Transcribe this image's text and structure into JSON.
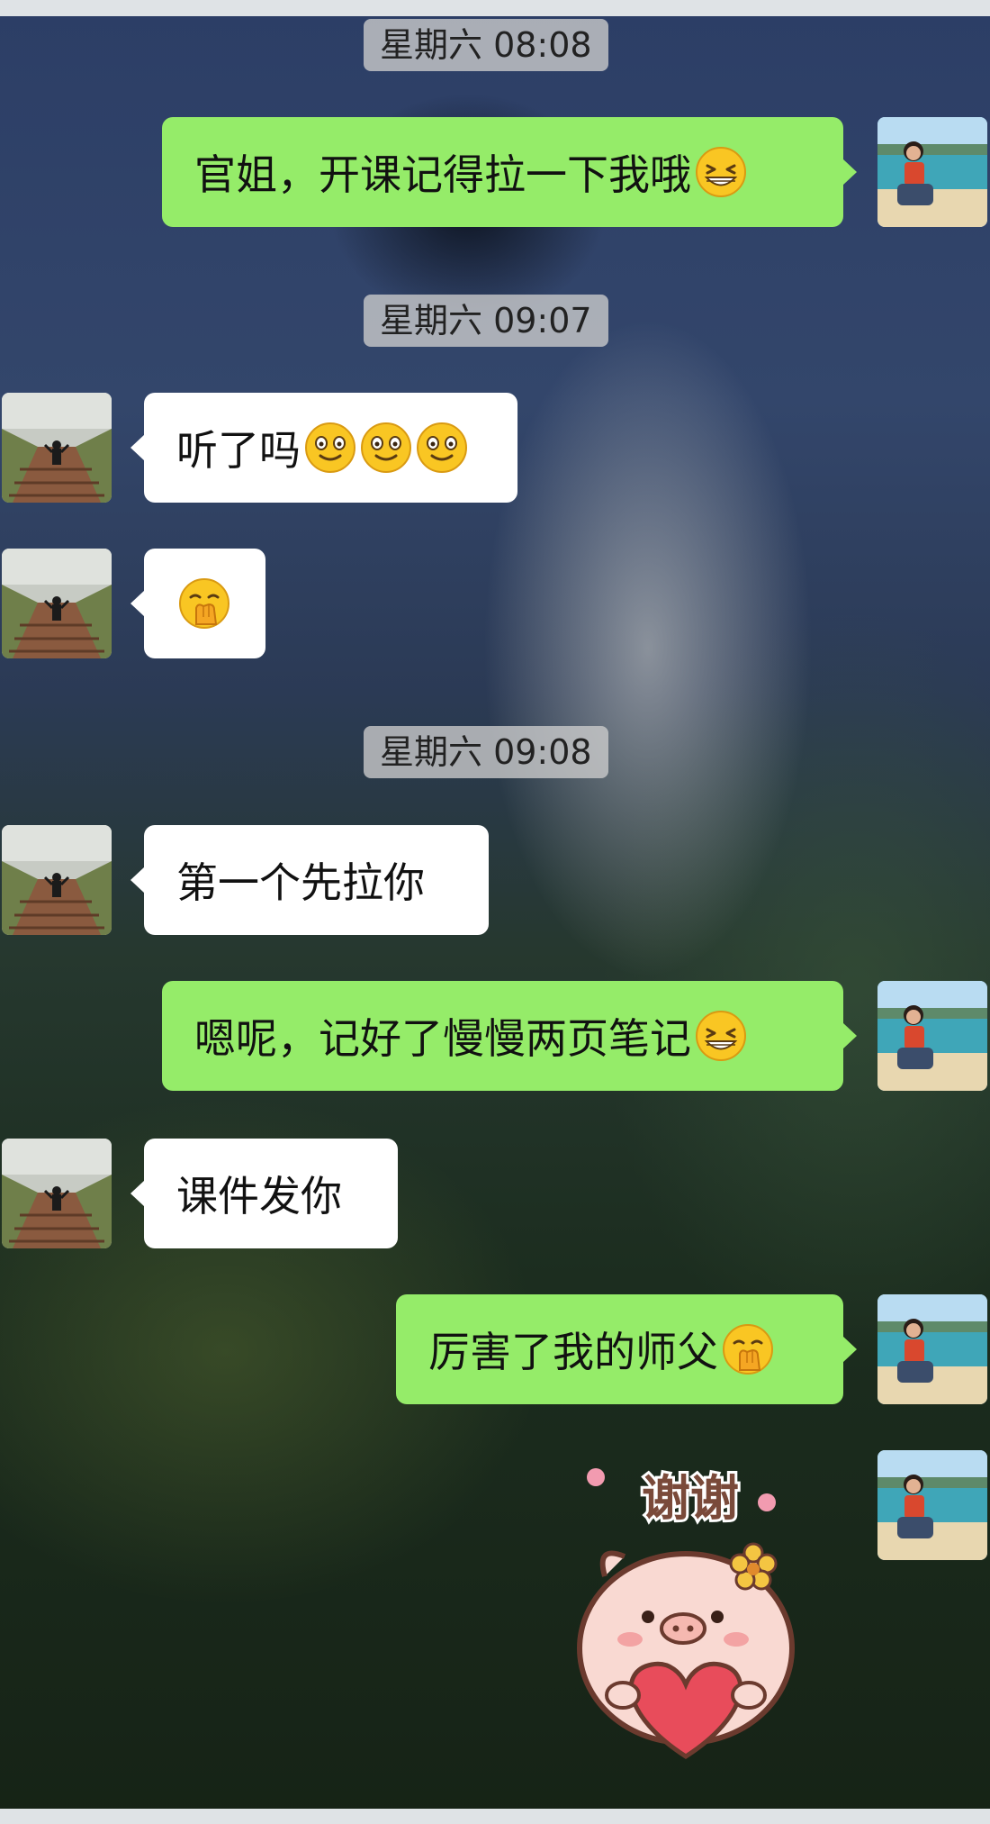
{
  "chat": {
    "messages": [
      {
        "type": "timestamp",
        "text": "星期六 08:08"
      },
      {
        "type": "message",
        "side": "me",
        "text": "官姐，开课记得拉一下我哦",
        "emoji": "grinning-squint-emoji"
      },
      {
        "type": "timestamp",
        "text": "星期六 09:07"
      },
      {
        "type": "message",
        "side": "them",
        "text": "听了吗",
        "emoji": [
          "smile-emoji",
          "smile-emoji",
          "smile-emoji"
        ]
      },
      {
        "type": "message",
        "side": "them",
        "text": "",
        "emoji": "hand-over-mouth-emoji"
      },
      {
        "type": "timestamp",
        "text": "星期六 09:08"
      },
      {
        "type": "message",
        "side": "them",
        "text": "第一个先拉你"
      },
      {
        "type": "message",
        "side": "me",
        "text": "嗯呢，记好了慢慢两页笔记",
        "emoji": "grinning-squint-emoji"
      },
      {
        "type": "message",
        "side": "them",
        "text": "课件发你"
      },
      {
        "type": "message",
        "side": "me",
        "text": "厉害了我的师父",
        "emoji": "hand-over-mouth-emoji"
      },
      {
        "type": "sticker",
        "side": "me",
        "caption": "谢谢",
        "icon": "pig-heart-sticker"
      }
    ]
  },
  "colors": {
    "my_bubble": "#95ec69",
    "their_bubble": "#ffffff",
    "timestamp_bg": "#cdcdcd"
  }
}
